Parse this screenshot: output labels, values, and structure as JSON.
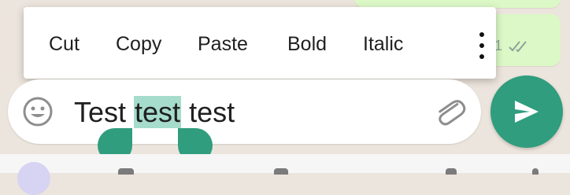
{
  "context_menu": {
    "items": [
      "Cut",
      "Copy",
      "Paste",
      "Bold",
      "Italic"
    ],
    "more_icon": "more-vertical-icon"
  },
  "compose": {
    "text_before": "Test ",
    "text_selected": "test",
    "text_after": " test",
    "emoji_icon": "emoji-icon",
    "attach_icon": "paperclip-icon",
    "send_icon": "send-icon"
  },
  "message": {
    "status_icon": "double-check-icon"
  },
  "colors": {
    "accent": "#2f9d7e",
    "selection": "#a6dccb",
    "chat_background": "#ece5dd",
    "outgoing_bubble": "#dcf8c6"
  }
}
